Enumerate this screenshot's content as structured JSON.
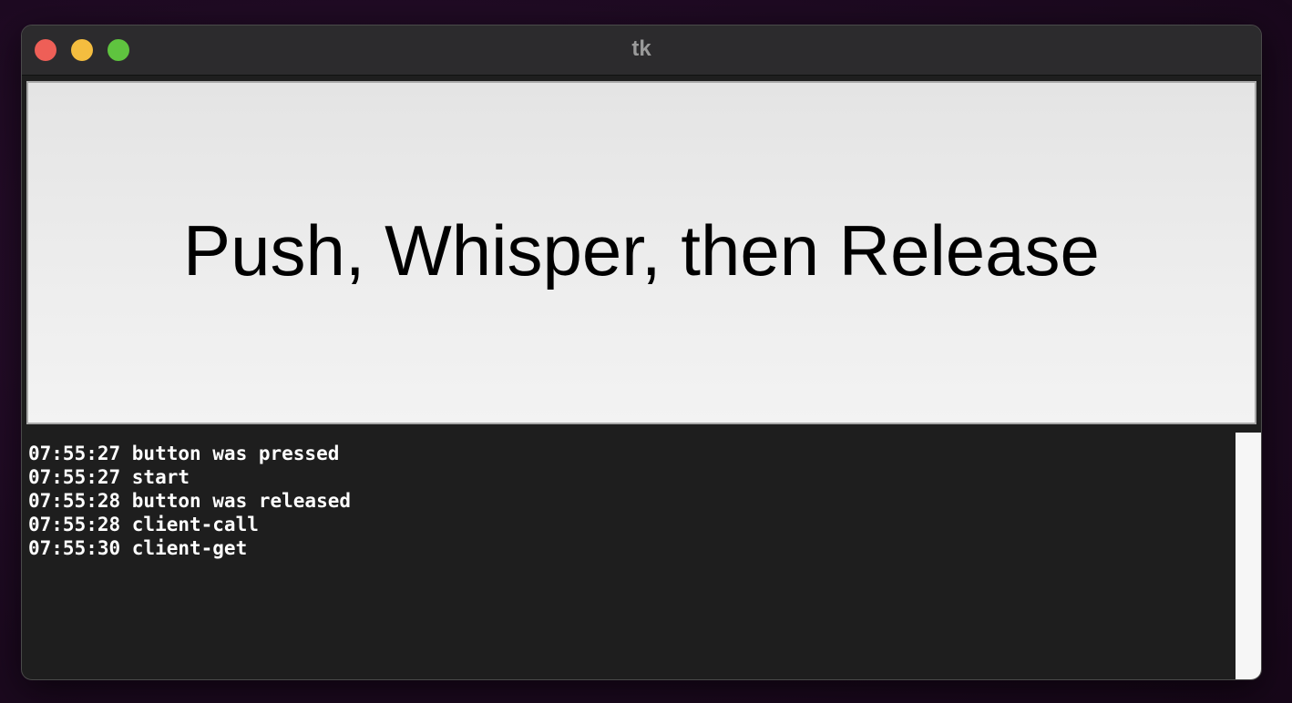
{
  "window": {
    "title": "tk"
  },
  "button": {
    "label": "Push, Whisper, then Release"
  },
  "log": {
    "lines": [
      "07:55:27 button was pressed",
      "07:55:27 start",
      "07:55:28 button was released",
      "07:55:28 client-call",
      "07:55:30 client-get"
    ]
  },
  "colors": {
    "close": "#ee5f57",
    "minimize": "#f4bd3f",
    "zoom": "#5fc43f",
    "log_background": "#1e1e1e",
    "log_text": "#ffffff"
  }
}
